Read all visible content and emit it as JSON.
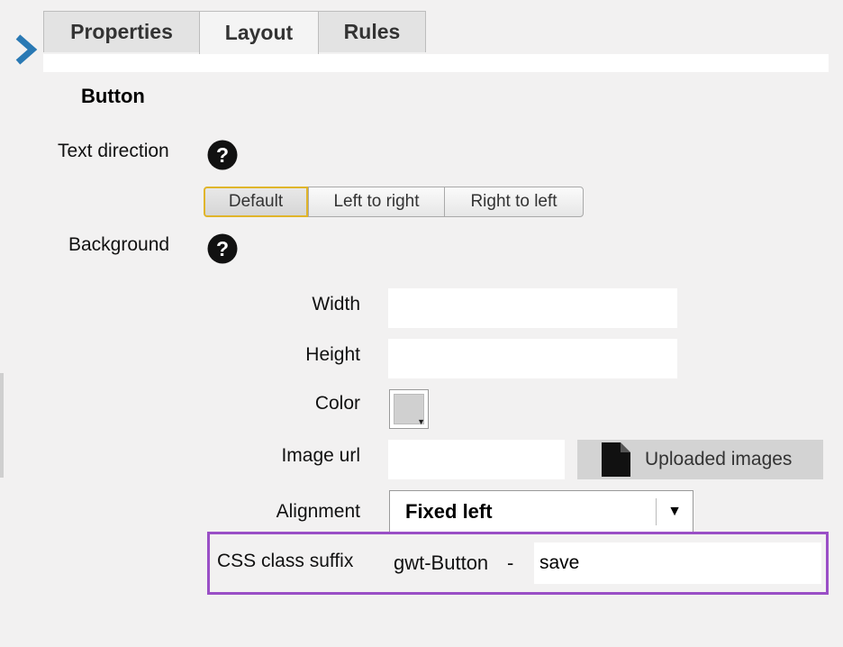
{
  "tabs": [
    {
      "label": "Properties"
    },
    {
      "label": "Layout"
    },
    {
      "label": "Rules"
    }
  ],
  "active_tab": "Layout",
  "section_title": "Button",
  "text_direction": {
    "label": "Text direction",
    "options": [
      "Default",
      "Left to right",
      "Right to left"
    ],
    "selected": "Default"
  },
  "background": {
    "label": "Background",
    "width": {
      "label": "Width",
      "value": ""
    },
    "height": {
      "label": "Height",
      "value": ""
    },
    "color": {
      "label": "Color",
      "swatch": "#d0d0d0"
    },
    "image_url": {
      "label": "Image url",
      "value": ""
    },
    "uploaded_images_label": "Uploaded images"
  },
  "alignment": {
    "label": "Alignment",
    "selected": "Fixed left"
  },
  "css_class_suffix": {
    "label": "CSS class suffix",
    "prefix": "gwt-Button",
    "separator": "-",
    "value": "save"
  },
  "colors": {
    "highlight_border": "#9a4fc6",
    "selected_segment_border": "#e0b52b",
    "expand_arrow": "#2a79b4"
  },
  "icons": [
    "expand-arrow-icon",
    "help-icon",
    "document-icon",
    "dropdown-arrow-icon"
  ]
}
